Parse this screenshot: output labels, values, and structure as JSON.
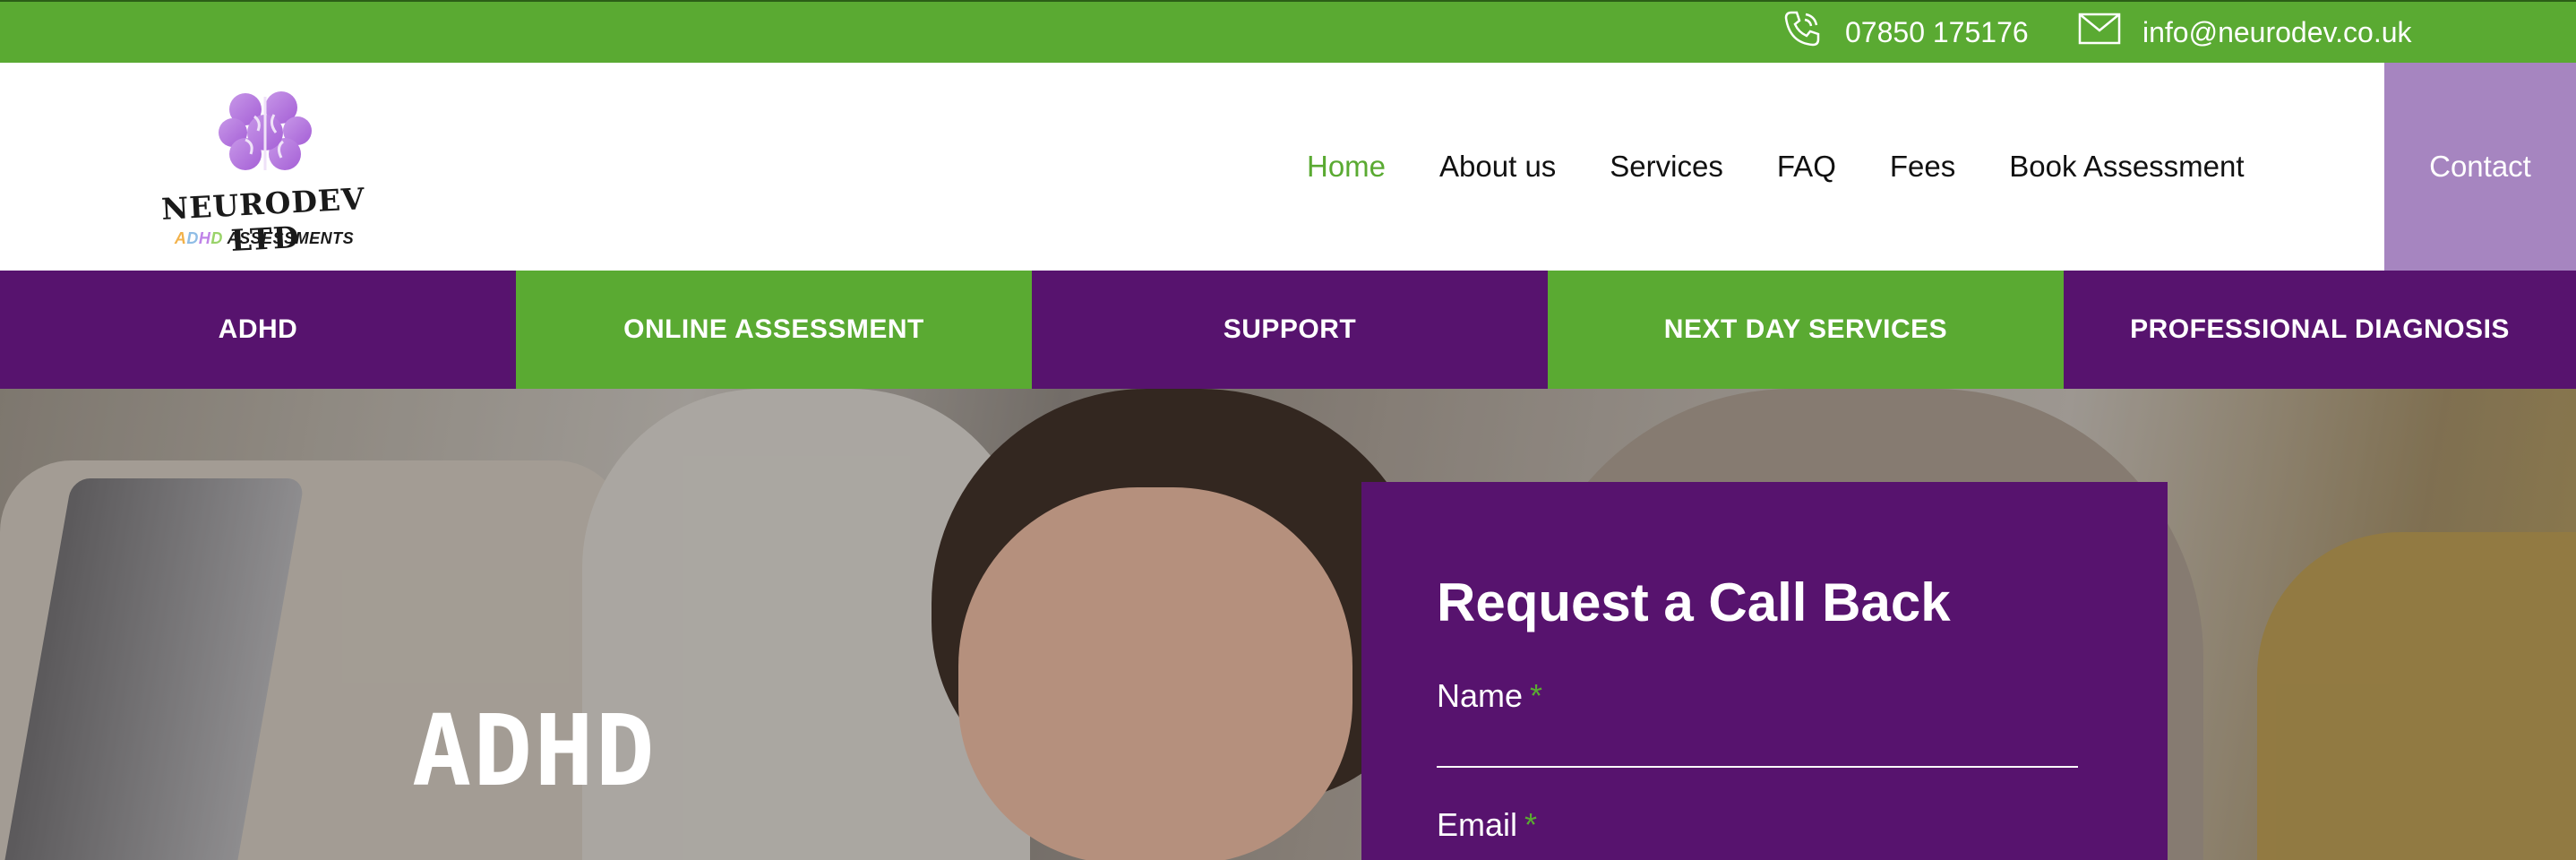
{
  "topbar": {
    "phone": "07850 175176",
    "email": "info@neurodev.co.uk",
    "phone_icon": "phone-icon",
    "email_icon": "envelope-icon"
  },
  "logo": {
    "name": "NEURODEV LTD",
    "tagline_a": "A",
    "tagline_d": "D",
    "tagline_h": "H",
    "tagline_d2": "D",
    "tagline_rest": " ASSESSMENTS"
  },
  "nav": {
    "items": [
      "Home",
      "About us",
      "Services",
      "FAQ",
      "Fees",
      "Book Assessment"
    ],
    "active": "Home",
    "contact": "Contact"
  },
  "categories": [
    "ADHD",
    "ONLINE ASSESSMENT",
    "SUPPORT",
    "NEXT DAY SERVICES",
    "PROFESSIONAL DIAGNOSIS"
  ],
  "hero": {
    "title": "ADHD"
  },
  "form": {
    "title": "Request a Call Back",
    "name_label": "Name",
    "email_label": "Email",
    "required_mark": "*"
  },
  "colors": {
    "green": "#5aaa32",
    "purple": "#57136e",
    "lilac": "#a685c0"
  }
}
